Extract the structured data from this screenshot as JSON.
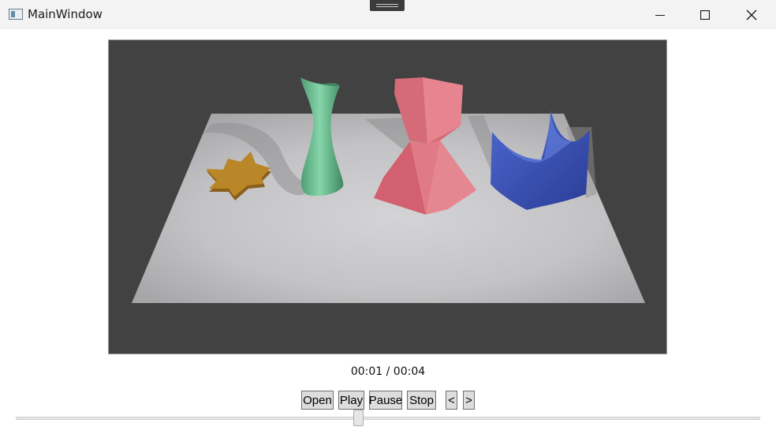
{
  "window": {
    "title": "MainWindow",
    "controls": [
      "minimize-icon",
      "maximize-icon",
      "close-icon"
    ]
  },
  "viewport": {
    "scene_objects": [
      "star",
      "vase",
      "twisted-prism",
      "crown-bowl",
      "floor-plane"
    ],
    "colors": {
      "background": "#424242",
      "floor": "#c8c8c8",
      "star": "#b5802a",
      "vase": "#6fbf94",
      "prism": "#e07b86",
      "crown": "#3b55b8"
    }
  },
  "playback": {
    "time_display": "00:01 / 00:04",
    "position_fraction": 0.46
  },
  "controls": {
    "open_label": "Open",
    "play_label": "Play",
    "pause_label": "Pause",
    "stop_label": "Stop",
    "prev_label": "<",
    "next_label": ">"
  }
}
